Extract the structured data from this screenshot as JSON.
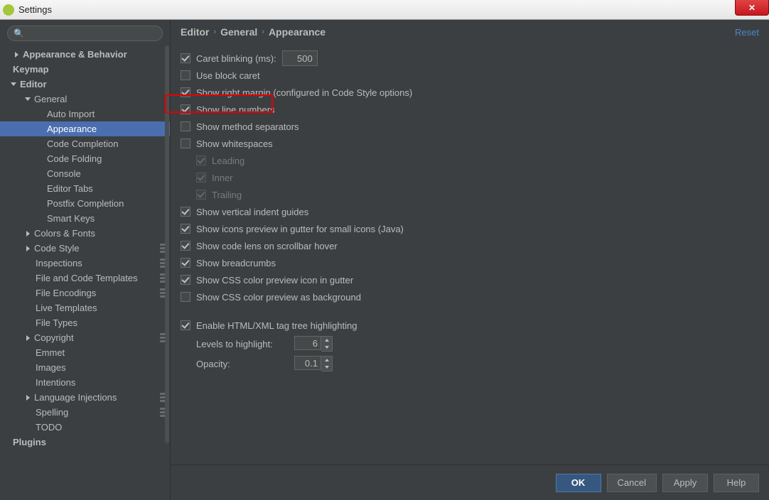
{
  "window": {
    "title": "Settings"
  },
  "search": {
    "placeholder": ""
  },
  "breadcrumb": [
    "Editor",
    "General",
    "Appearance"
  ],
  "reset_label": "Reset",
  "tree": {
    "appearance_behavior": "Appearance & Behavior",
    "keymap": "Keymap",
    "editor": "Editor",
    "general": "General",
    "auto_import": "Auto Import",
    "appearance": "Appearance",
    "code_completion": "Code Completion",
    "code_folding": "Code Folding",
    "console": "Console",
    "editor_tabs": "Editor Tabs",
    "postfix_completion": "Postfix Completion",
    "smart_keys": "Smart Keys",
    "colors_fonts": "Colors & Fonts",
    "code_style": "Code Style",
    "inspections": "Inspections",
    "file_code_templates": "File and Code Templates",
    "file_encodings": "File Encodings",
    "live_templates": "Live Templates",
    "file_types": "File Types",
    "copyright": "Copyright",
    "emmet": "Emmet",
    "images": "Images",
    "intentions": "Intentions",
    "language_injections": "Language Injections",
    "spelling": "Spelling",
    "todo": "TODO",
    "plugins": "Plugins"
  },
  "opts": {
    "caret_blinking": "Caret blinking (ms):",
    "caret_blinking_value": "500",
    "use_block_caret": "Use block caret",
    "show_right_margin": "Show right margin (configured in Code Style options)",
    "show_line_numbers": "Show line numbers",
    "show_method_separators": "Show method separators",
    "show_whitespaces": "Show whitespaces",
    "leading": "Leading",
    "inner": "Inner",
    "trailing": "Trailing",
    "show_vertical_indent": "Show vertical indent guides",
    "show_icons_preview": "Show icons preview in gutter for small icons (Java)",
    "show_code_lens": "Show code lens on scrollbar hover",
    "show_breadcrumbs": "Show breadcrumbs",
    "show_css_icon": "Show CSS color preview icon in gutter",
    "show_css_bg": "Show CSS color preview as background",
    "enable_html_xml": "Enable HTML/XML tag tree highlighting",
    "levels_to_highlight": "Levels to highlight:",
    "levels_value": "6",
    "opacity": "Opacity:",
    "opacity_value": "0.1"
  },
  "buttons": {
    "ok": "OK",
    "cancel": "Cancel",
    "apply": "Apply",
    "help": "Help"
  }
}
